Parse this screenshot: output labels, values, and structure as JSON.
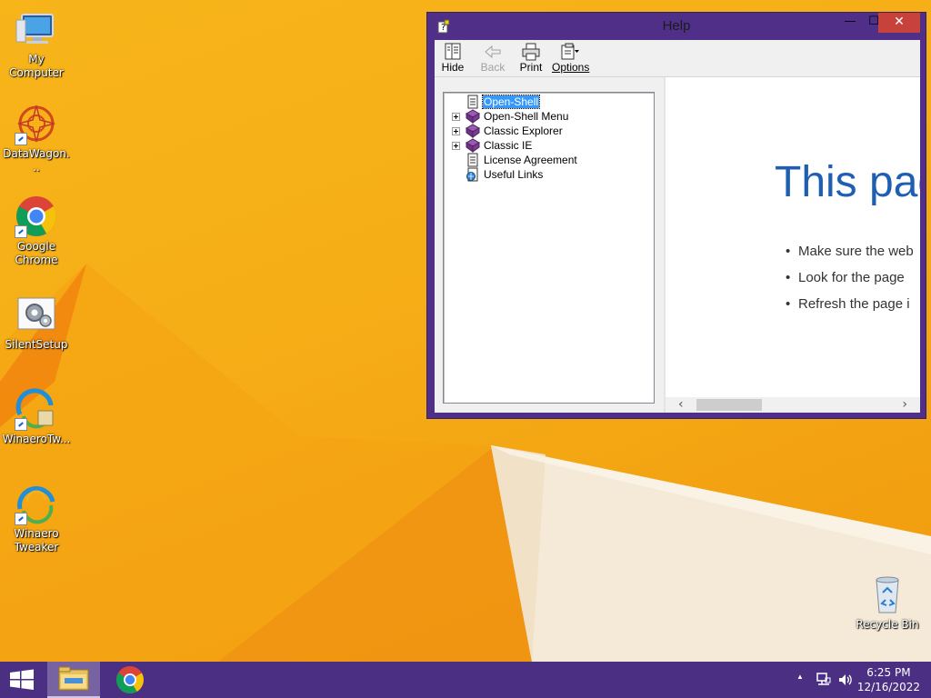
{
  "desktop": {
    "icons": [
      {
        "label": "My Computer",
        "icon": "computer-icon",
        "shortcut": false
      },
      {
        "label": "DataWagon...",
        "icon": "datawagon-icon",
        "shortcut": true
      },
      {
        "label": "Google Chrome",
        "icon": "chrome-icon",
        "shortcut": true
      },
      {
        "label": "SilentSetup",
        "icon": "silentsetup-icon",
        "shortcut": false
      },
      {
        "label": "WinaeroTw...",
        "icon": "winaero-tweaker-icon",
        "shortcut": true
      },
      {
        "label": "Winaero Tweaker",
        "icon": "winaero-tweaker-icon",
        "shortcut": true
      },
      {
        "label": "Recycle Bin",
        "icon": "recycle-bin-icon",
        "shortcut": false
      }
    ]
  },
  "help_window": {
    "title": "Help",
    "title_controls": {
      "minimize": "—",
      "maximize": "☐",
      "close": "✕"
    },
    "toolbar": {
      "hide": "Hide",
      "back": "Back",
      "print": "Print",
      "options": "Options"
    },
    "tree": [
      {
        "label": "Open-Shell",
        "icon": "page-icon",
        "expandable": false,
        "selected": true
      },
      {
        "label": "Open-Shell Menu",
        "icon": "book-icon",
        "expandable": true,
        "selected": false
      },
      {
        "label": "Classic Explorer",
        "icon": "book-icon",
        "expandable": true,
        "selected": false
      },
      {
        "label": "Classic IE",
        "icon": "book-icon",
        "expandable": true,
        "selected": false
      },
      {
        "label": "License Agreement",
        "icon": "page-icon",
        "expandable": false,
        "selected": false
      },
      {
        "label": "Useful Links",
        "icon": "web-page-icon",
        "expandable": false,
        "selected": false
      }
    ],
    "content": {
      "heading": "This pag",
      "bullets": [
        "Make sure the web",
        "Look for the page",
        "Refresh the page i"
      ]
    },
    "scroll_left": "‹",
    "scroll_right": "›"
  },
  "taskbar": {
    "apps": [
      {
        "name": "file-explorer",
        "icon": "folder-icon",
        "active": true
      },
      {
        "name": "google-chrome",
        "icon": "chrome-icon",
        "active": false
      }
    ],
    "tray": {
      "show_hidden": "▲",
      "time": "6:25 PM",
      "date": "12/16/2022"
    }
  },
  "colors": {
    "window_frame": "#4f2f87",
    "taskbar": "#4a2f83",
    "close_button": "#c7423b",
    "heading_blue": "#1e5fb4",
    "selection": "#3399ff"
  }
}
